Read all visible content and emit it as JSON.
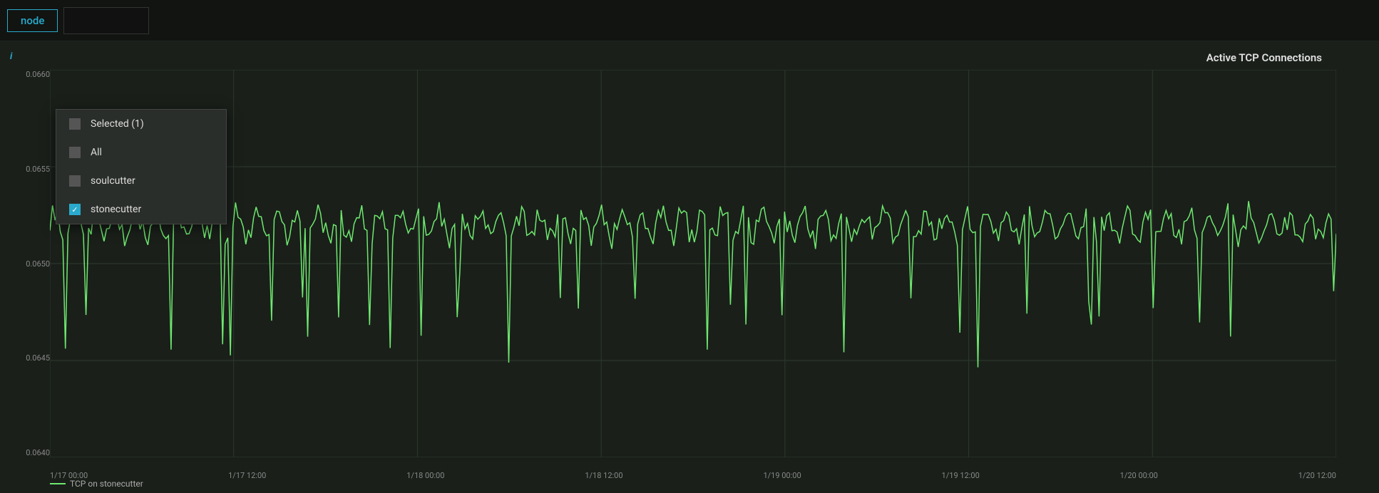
{
  "topbar": {
    "tab_node_label": "node",
    "tab_dark_label": ""
  },
  "chart": {
    "title": "Active TCP Connections",
    "info_icon": "i",
    "y_labels": [
      "0.0660",
      "0.0655",
      "0.0650",
      "0.0645",
      "0.0640"
    ],
    "x_labels": [
      "1/17 00:00",
      "1/17 12:00",
      "1/18 00:00",
      "1/18 12:00",
      "1/19 00:00",
      "1/19 12:00",
      "1/20 00:00",
      "1/20 12:00"
    ],
    "legend_text": "TCP on stonecutter",
    "accent_color": "#6ee86e"
  },
  "dropdown": {
    "items": [
      {
        "label": "Selected (1)",
        "checked": false,
        "checkmark": ""
      },
      {
        "label": "All",
        "checked": false,
        "checkmark": ""
      },
      {
        "label": "soulcutter",
        "checked": false,
        "checkmark": ""
      },
      {
        "label": "stonecutter",
        "checked": true,
        "checkmark": "✓"
      }
    ]
  }
}
